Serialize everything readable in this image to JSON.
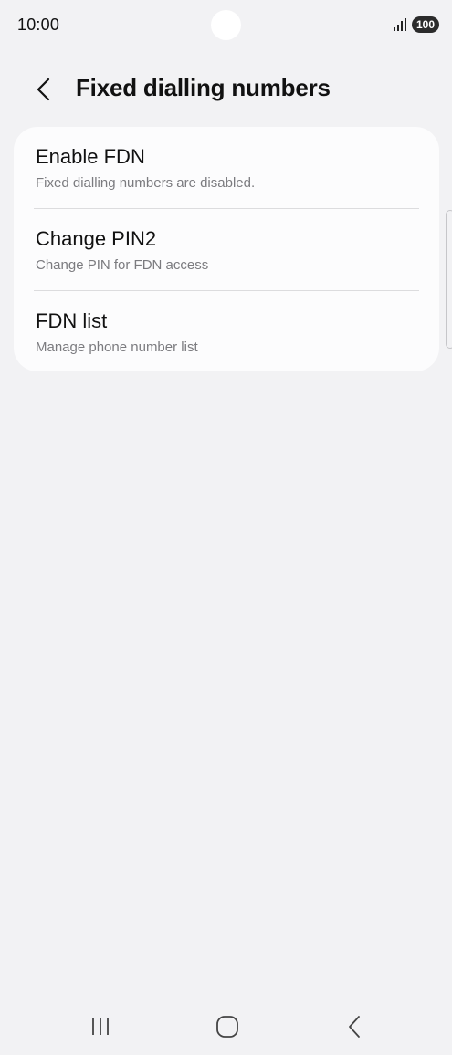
{
  "status_bar": {
    "time": "10:00",
    "battery": "100",
    "signal_icon": "signal-bars-icon"
  },
  "header": {
    "back_icon": "chevron-left-icon",
    "title": "Fixed dialling numbers"
  },
  "settings": {
    "items": [
      {
        "title": "Enable FDN",
        "subtitle": "Fixed dialling numbers are disabled."
      },
      {
        "title": "Change PIN2",
        "subtitle": "Change PIN for FDN access"
      },
      {
        "title": "FDN list",
        "subtitle": "Manage phone number list"
      }
    ]
  },
  "nav_bar": {
    "recents_icon": "recent-apps-icon",
    "home_icon": "home-icon",
    "back_icon": "back-icon"
  },
  "colors": {
    "background": "#f2f2f4",
    "card": "#fcfcfd",
    "text_primary": "#111111",
    "text_secondary": "#7b7b7f"
  }
}
